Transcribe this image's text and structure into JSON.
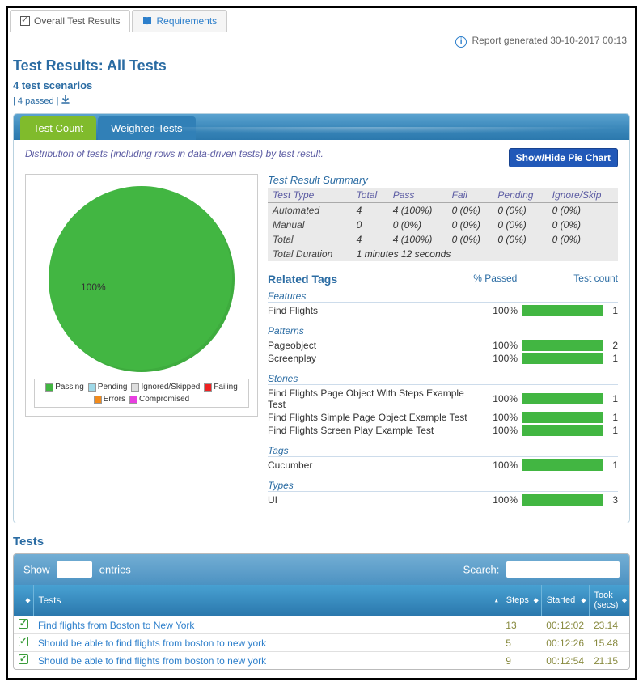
{
  "outer_tabs": {
    "overall": "Overall Test Results",
    "requirements": "Requirements"
  },
  "report_generated": "Report generated 30-10-2017 00:13",
  "page_title": "Test Results: All Tests",
  "subtitle": "4 test scenarios",
  "pass_summary": "| 4 passed | ",
  "inner_tabs": {
    "test_count": "Test Count",
    "weighted": "Weighted Tests"
  },
  "description": "Distribution of tests (including rows in data-driven tests) by test result.",
  "toggle_button": "Show/Hide Pie Chart",
  "chart_data": {
    "type": "pie",
    "title": "",
    "series": [
      {
        "name": "Passing",
        "value": 100
      }
    ],
    "label": "100%"
  },
  "legend": {
    "passing": "Passing",
    "pending": "Pending",
    "ignored": "Ignored/Skipped",
    "failing": "Failing",
    "errors": "Errors",
    "compromised": "Compromised"
  },
  "legend_colors": {
    "passing": "#42b642",
    "pending": "#9fd9e8",
    "ignored": "#dedede",
    "failing": "#ee2222",
    "errors": "#f28b1c",
    "compromised": "#e83fe0"
  },
  "summary": {
    "title": "Test Result Summary",
    "headers": {
      "type": "Test Type",
      "total": "Total",
      "pass": "Pass",
      "fail": "Fail",
      "pending": "Pending",
      "ignore": "Ignore/Skip"
    },
    "rows": [
      {
        "type": "Automated",
        "total": "4",
        "pass": "4 (100%)",
        "fail": "0 (0%)",
        "pending": "0 (0%)",
        "ignore": "0 (0%)"
      },
      {
        "type": "Manual",
        "total": "0",
        "pass": "0 (0%)",
        "fail": "0 (0%)",
        "pending": "0 (0%)",
        "ignore": "0 (0%)"
      },
      {
        "type": "Total",
        "total": "4",
        "pass": "4 (100%)",
        "fail": "0 (0%)",
        "pending": "0 (0%)",
        "ignore": "0 (0%)"
      }
    ],
    "duration_label": "Total Duration",
    "duration_value": "1 minutes 12 seconds"
  },
  "related": {
    "title": "Related Tags",
    "col_passed": "% Passed",
    "col_count": "Test count",
    "groups": [
      {
        "label": "Features",
        "items": [
          {
            "name": "Find Flights",
            "pct": "100%",
            "count": "1"
          }
        ]
      },
      {
        "label": "Patterns",
        "items": [
          {
            "name": "Pageobject",
            "pct": "100%",
            "count": "2"
          },
          {
            "name": "Screenplay",
            "pct": "100%",
            "count": "1"
          }
        ]
      },
      {
        "label": "Stories",
        "items": [
          {
            "name": "Find Flights Page Object With Steps Example Test",
            "pct": "100%",
            "count": "1"
          },
          {
            "name": "Find Flights Simple Page Object Example Test",
            "pct": "100%",
            "count": "1"
          },
          {
            "name": "Find Flights Screen Play Example Test",
            "pct": "100%",
            "count": "1"
          }
        ]
      },
      {
        "label": "Tags",
        "items": [
          {
            "name": "Cucumber",
            "pct": "100%",
            "count": "1"
          }
        ]
      },
      {
        "label": "Types",
        "items": [
          {
            "name": "UI",
            "pct": "100%",
            "count": "3"
          }
        ]
      }
    ]
  },
  "tests": {
    "heading": "Tests",
    "show_label": "Show",
    "entries_label": "entries",
    "search_label": "Search:",
    "headers": {
      "tests": "Tests",
      "steps": "Steps",
      "started": "Started",
      "took": "Took (secs)"
    },
    "rows": [
      {
        "name": "Find flights from Boston to New York",
        "steps": "13",
        "started": "00:12:02",
        "took": "23.14"
      },
      {
        "name": "Should be able to find flights from boston to new york",
        "steps": "5",
        "started": "00:12:26",
        "took": "15.48"
      },
      {
        "name": "Should be able to find flights from boston to new york",
        "steps": "9",
        "started": "00:12:54",
        "took": "21.15"
      }
    ]
  }
}
